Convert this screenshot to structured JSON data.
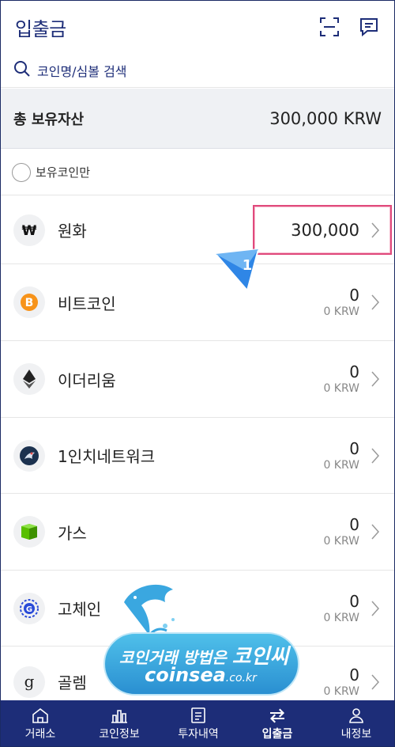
{
  "header": {
    "title": "입출금",
    "icons": [
      "scan-icon",
      "chat-icon"
    ]
  },
  "search": {
    "placeholder": "코인명/심볼 검색"
  },
  "total": {
    "label": "총 보유자산",
    "value": "300,000 KRW"
  },
  "filter": {
    "label": "보유코인만"
  },
  "coins": [
    {
      "name": "원화",
      "amount": "300,000",
      "krw": "",
      "icon": "won-icon"
    },
    {
      "name": "비트코인",
      "amount": "0",
      "krw": "0 KRW",
      "icon": "bitcoin-icon"
    },
    {
      "name": "이더리움",
      "amount": "0",
      "krw": "0 KRW",
      "icon": "ethereum-icon"
    },
    {
      "name": "1인치네트워크",
      "amount": "0",
      "krw": "0 KRW",
      "icon": "1inch-icon"
    },
    {
      "name": "가스",
      "amount": "0",
      "krw": "0 KRW",
      "icon": "gas-icon"
    },
    {
      "name": "고체인",
      "amount": "0",
      "krw": "0 KRW",
      "icon": "gochain-icon"
    },
    {
      "name": "골렘",
      "amount": "0",
      "krw": "0 KRW",
      "icon": "golem-icon"
    }
  ],
  "annotation": {
    "badge": "1"
  },
  "nav": [
    {
      "label": "거래소",
      "icon": "home-icon",
      "active": false
    },
    {
      "label": "코인정보",
      "icon": "chart-icon",
      "active": false
    },
    {
      "label": "투자내역",
      "icon": "document-icon",
      "active": false
    },
    {
      "label": "입출금",
      "icon": "transfer-icon",
      "active": true
    },
    {
      "label": "내정보",
      "icon": "user-icon",
      "active": false
    }
  ],
  "watermark": {
    "line1_a": "코인거래 방법은",
    "line1_b": "코인씨",
    "line2_a": "coinsea",
    "line2_b": ".co.kr"
  },
  "colors": {
    "brand": "#1d2d78",
    "highlight": "#e04a7c",
    "bitcoin": "#f7931a",
    "gas": "#58bf00"
  }
}
